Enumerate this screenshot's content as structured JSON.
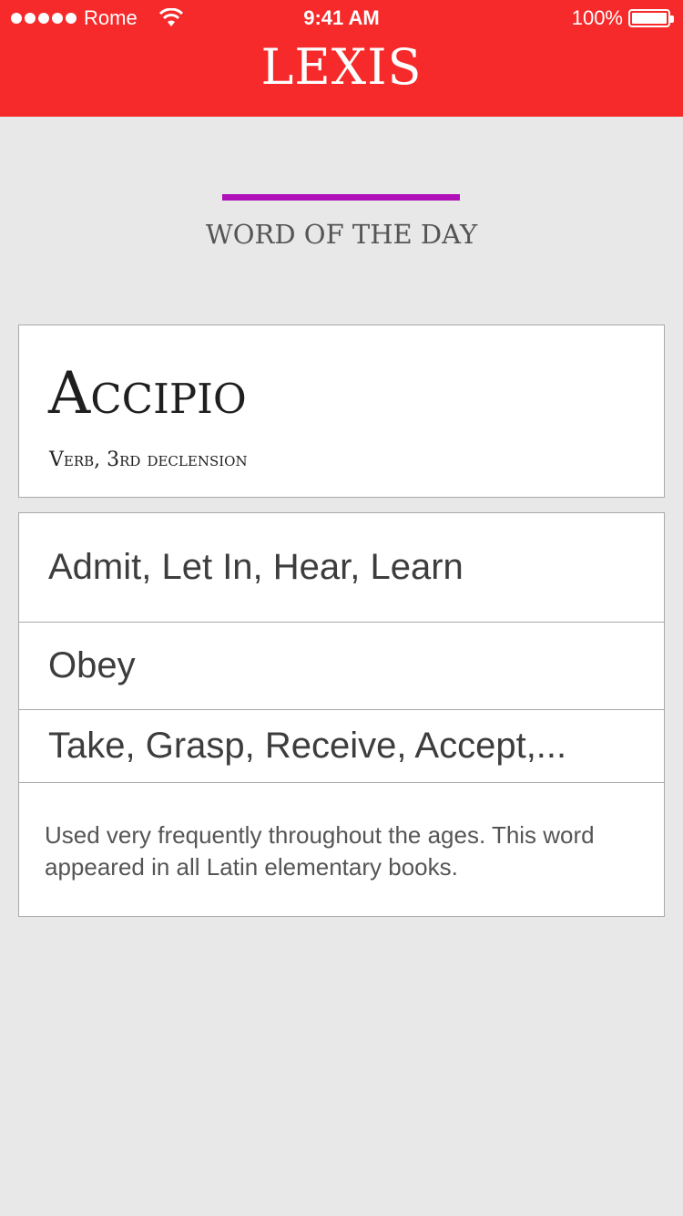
{
  "status_bar": {
    "carrier": "Rome",
    "time": "9:41 AM",
    "battery": "100%"
  },
  "header": {
    "title": "LEXIS",
    "color": "#f62a2a"
  },
  "section": {
    "title": "WORD OF THE DAY",
    "accent_color": "#b010b8"
  },
  "word_card": {
    "word": "Accipio",
    "part_of_speech": "Verb, 3rd declension"
  },
  "meanings": [
    "Admit, Let In, Hear, Learn",
    "Obey",
    "Take, Grasp, Receive, Accept,..."
  ],
  "note": "Used very frequently throughout the ages. This word appeared in all Latin elementary books."
}
